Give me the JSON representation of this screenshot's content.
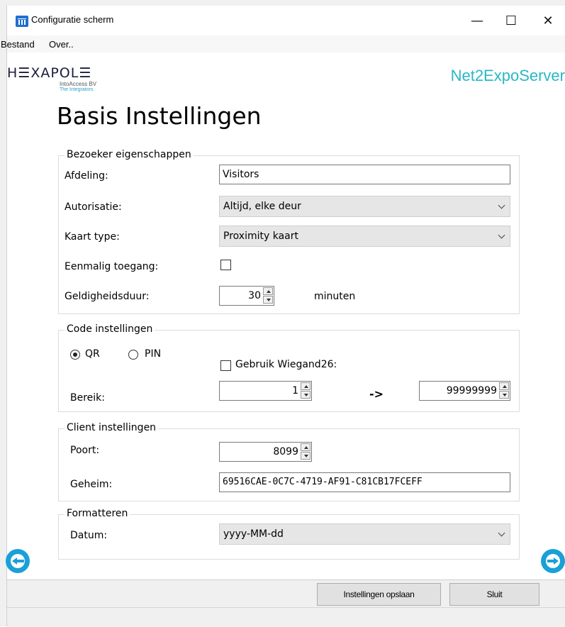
{
  "window": {
    "title": "Configuratie scherm",
    "minimize_glyph": "—",
    "maximize_glyph": "☐",
    "close_glyph": "✕"
  },
  "menu": {
    "items": [
      "Bestand",
      "Over.."
    ]
  },
  "brand": {
    "logo_text": "H☰XAPOL☰",
    "logo_sub1": "IntoAccess BV",
    "logo_sub2": "The Integrators",
    "app_name": "Net2ExpoServer"
  },
  "page": {
    "title": "Basis Instellingen"
  },
  "bezoeker": {
    "title": "Bezoeker eigenschappen",
    "afdeling_label": "Afdeling:",
    "afdeling_value": "Visitors",
    "autorisatie_label": "Autorisatie:",
    "autorisatie_value": "Altijd, elke deur",
    "kaarttype_label": "Kaart type:",
    "kaarttype_value": "Proximity kaart",
    "eenmalig_label": "Eenmalig toegang:",
    "eenmalig_checked": false,
    "geldigheid_label": "Geldigheidsduur:",
    "geldigheid_value": "30",
    "geldigheid_unit": "minuten"
  },
  "code": {
    "title": "Code instellingen",
    "qr_label": "QR",
    "pin_label": "PIN",
    "selected": "QR",
    "wiegand_label": "Gebruik Wiegand26:",
    "wiegand_checked": false,
    "bereik_label": "Bereik:",
    "bereik_from": "1",
    "arrow": "->",
    "bereik_to": "99999999"
  },
  "client": {
    "title": "Client instellingen",
    "poort_label": "Poort:",
    "poort_value": "8099",
    "geheim_label": "Geheim:",
    "geheim_value": "69516CAE-0C7C-4719-AF91-C81CB17FCEFF"
  },
  "format": {
    "title": "Formatteren",
    "datum_label": "Datum:",
    "datum_value": "yyyy-MM-dd"
  },
  "buttons": {
    "save": "Instellingen opslaan",
    "close": "Sluit"
  },
  "colors": {
    "accent": "#1aa0d8",
    "brand_text": "#2ab7c4"
  }
}
